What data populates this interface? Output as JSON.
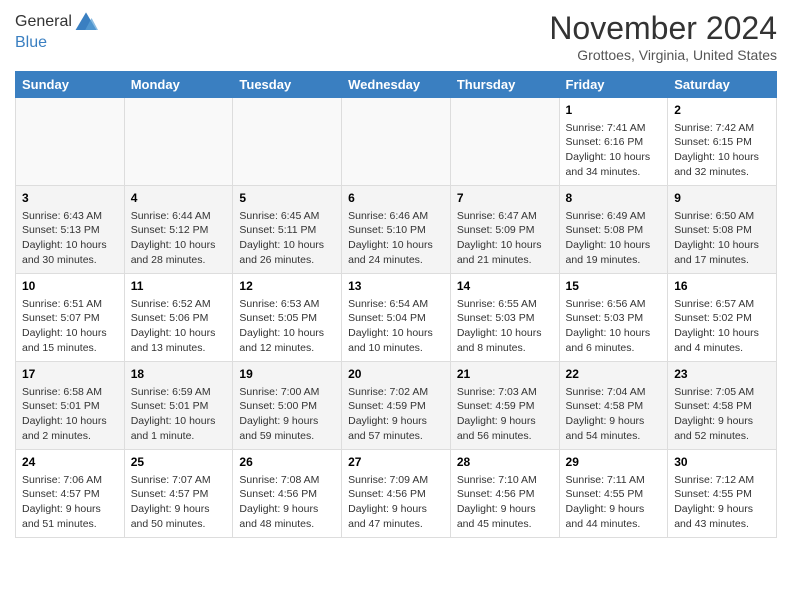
{
  "logo": {
    "line1": "General",
    "line2": "Blue"
  },
  "title": "November 2024",
  "location": "Grottoes, Virginia, United States",
  "days_of_week": [
    "Sunday",
    "Monday",
    "Tuesday",
    "Wednesday",
    "Thursday",
    "Friday",
    "Saturday"
  ],
  "weeks": [
    [
      {
        "day": "",
        "info": ""
      },
      {
        "day": "",
        "info": ""
      },
      {
        "day": "",
        "info": ""
      },
      {
        "day": "",
        "info": ""
      },
      {
        "day": "",
        "info": ""
      },
      {
        "day": "1",
        "info": "Sunrise: 7:41 AM\nSunset: 6:16 PM\nDaylight: 10 hours\nand 34 minutes."
      },
      {
        "day": "2",
        "info": "Sunrise: 7:42 AM\nSunset: 6:15 PM\nDaylight: 10 hours\nand 32 minutes."
      }
    ],
    [
      {
        "day": "3",
        "info": "Sunrise: 6:43 AM\nSunset: 5:13 PM\nDaylight: 10 hours\nand 30 minutes."
      },
      {
        "day": "4",
        "info": "Sunrise: 6:44 AM\nSunset: 5:12 PM\nDaylight: 10 hours\nand 28 minutes."
      },
      {
        "day": "5",
        "info": "Sunrise: 6:45 AM\nSunset: 5:11 PM\nDaylight: 10 hours\nand 26 minutes."
      },
      {
        "day": "6",
        "info": "Sunrise: 6:46 AM\nSunset: 5:10 PM\nDaylight: 10 hours\nand 24 minutes."
      },
      {
        "day": "7",
        "info": "Sunrise: 6:47 AM\nSunset: 5:09 PM\nDaylight: 10 hours\nand 21 minutes."
      },
      {
        "day": "8",
        "info": "Sunrise: 6:49 AM\nSunset: 5:08 PM\nDaylight: 10 hours\nand 19 minutes."
      },
      {
        "day": "9",
        "info": "Sunrise: 6:50 AM\nSunset: 5:08 PM\nDaylight: 10 hours\nand 17 minutes."
      }
    ],
    [
      {
        "day": "10",
        "info": "Sunrise: 6:51 AM\nSunset: 5:07 PM\nDaylight: 10 hours\nand 15 minutes."
      },
      {
        "day": "11",
        "info": "Sunrise: 6:52 AM\nSunset: 5:06 PM\nDaylight: 10 hours\nand 13 minutes."
      },
      {
        "day": "12",
        "info": "Sunrise: 6:53 AM\nSunset: 5:05 PM\nDaylight: 10 hours\nand 12 minutes."
      },
      {
        "day": "13",
        "info": "Sunrise: 6:54 AM\nSunset: 5:04 PM\nDaylight: 10 hours\nand 10 minutes."
      },
      {
        "day": "14",
        "info": "Sunrise: 6:55 AM\nSunset: 5:03 PM\nDaylight: 10 hours\nand 8 minutes."
      },
      {
        "day": "15",
        "info": "Sunrise: 6:56 AM\nSunset: 5:03 PM\nDaylight: 10 hours\nand 6 minutes."
      },
      {
        "day": "16",
        "info": "Sunrise: 6:57 AM\nSunset: 5:02 PM\nDaylight: 10 hours\nand 4 minutes."
      }
    ],
    [
      {
        "day": "17",
        "info": "Sunrise: 6:58 AM\nSunset: 5:01 PM\nDaylight: 10 hours\nand 2 minutes."
      },
      {
        "day": "18",
        "info": "Sunrise: 6:59 AM\nSunset: 5:01 PM\nDaylight: 10 hours\nand 1 minute."
      },
      {
        "day": "19",
        "info": "Sunrise: 7:00 AM\nSunset: 5:00 PM\nDaylight: 9 hours\nand 59 minutes."
      },
      {
        "day": "20",
        "info": "Sunrise: 7:02 AM\nSunset: 4:59 PM\nDaylight: 9 hours\nand 57 minutes."
      },
      {
        "day": "21",
        "info": "Sunrise: 7:03 AM\nSunset: 4:59 PM\nDaylight: 9 hours\nand 56 minutes."
      },
      {
        "day": "22",
        "info": "Sunrise: 7:04 AM\nSunset: 4:58 PM\nDaylight: 9 hours\nand 54 minutes."
      },
      {
        "day": "23",
        "info": "Sunrise: 7:05 AM\nSunset: 4:58 PM\nDaylight: 9 hours\nand 52 minutes."
      }
    ],
    [
      {
        "day": "24",
        "info": "Sunrise: 7:06 AM\nSunset: 4:57 PM\nDaylight: 9 hours\nand 51 minutes."
      },
      {
        "day": "25",
        "info": "Sunrise: 7:07 AM\nSunset: 4:57 PM\nDaylight: 9 hours\nand 50 minutes."
      },
      {
        "day": "26",
        "info": "Sunrise: 7:08 AM\nSunset: 4:56 PM\nDaylight: 9 hours\nand 48 minutes."
      },
      {
        "day": "27",
        "info": "Sunrise: 7:09 AM\nSunset: 4:56 PM\nDaylight: 9 hours\nand 47 minutes."
      },
      {
        "day": "28",
        "info": "Sunrise: 7:10 AM\nSunset: 4:56 PM\nDaylight: 9 hours\nand 45 minutes."
      },
      {
        "day": "29",
        "info": "Sunrise: 7:11 AM\nSunset: 4:55 PM\nDaylight: 9 hours\nand 44 minutes."
      },
      {
        "day": "30",
        "info": "Sunrise: 7:12 AM\nSunset: 4:55 PM\nDaylight: 9 hours\nand 43 minutes."
      }
    ]
  ]
}
